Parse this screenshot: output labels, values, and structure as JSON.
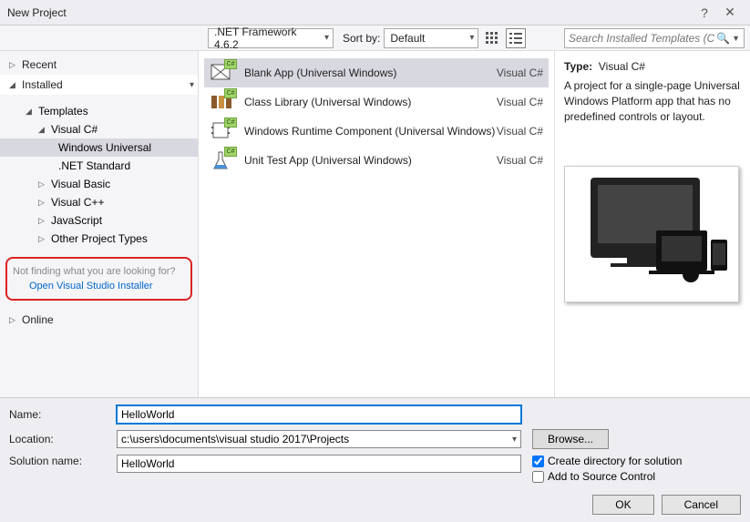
{
  "titlebar": {
    "title": "New Project",
    "help": "?",
    "close": "✕"
  },
  "toolbar": {
    "framework": ".NET Framework 4.6.2",
    "sortby_label": "Sort by:",
    "sortby_value": "Default",
    "search_placeholder": "Search Installed Templates (Ctrl-E)"
  },
  "tree": {
    "recent": "Recent",
    "installed": "Installed",
    "templates": "Templates",
    "visual_csharp": "Visual C#",
    "windows_universal": "Windows Universal",
    "net_standard": ".NET Standard",
    "visual_basic": "Visual Basic",
    "visual_cpp": "Visual C++",
    "javascript": "JavaScript",
    "other": "Other Project Types",
    "hint": "Not finding what you are looking for?",
    "hint_link": "Open Visual Studio Installer",
    "online": "Online"
  },
  "templates": [
    {
      "label": "Blank App (Universal Windows)",
      "lang": "Visual C#"
    },
    {
      "label": "Class Library (Universal Windows)",
      "lang": "Visual C#"
    },
    {
      "label": "Windows Runtime Component (Universal Windows)",
      "lang": "Visual C#"
    },
    {
      "label": "Unit Test App (Universal Windows)",
      "lang": "Visual C#"
    }
  ],
  "detail": {
    "type_label": "Type:",
    "type_value": "Visual C#",
    "desc": "A project for a single-page Universal Windows Platform app that has no predefined controls or layout."
  },
  "form": {
    "name_label": "Name:",
    "name_value": "HelloWorld",
    "location_label": "Location:",
    "location_value": "c:\\users\\documents\\visual studio 2017\\Projects",
    "solution_label": "Solution name:",
    "solution_value": "HelloWorld",
    "browse": "Browse...",
    "chk_createdir": "Create directory for solution",
    "chk_sourcectl": "Add to Source Control",
    "ok": "OK",
    "cancel": "Cancel"
  }
}
